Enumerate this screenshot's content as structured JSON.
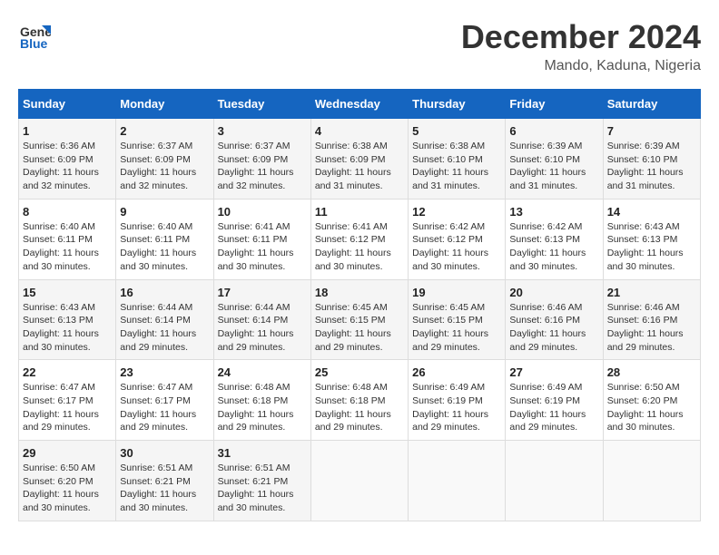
{
  "logo": {
    "line1": "General",
    "line2": "Blue"
  },
  "title": "December 2024",
  "subtitle": "Mando, Kaduna, Nigeria",
  "header": {
    "days": [
      "Sunday",
      "Monday",
      "Tuesday",
      "Wednesday",
      "Thursday",
      "Friday",
      "Saturday"
    ]
  },
  "weeks": [
    [
      {
        "day": "1",
        "info": "Sunrise: 6:36 AM\nSunset: 6:09 PM\nDaylight: 11 hours\nand 32 minutes."
      },
      {
        "day": "2",
        "info": "Sunrise: 6:37 AM\nSunset: 6:09 PM\nDaylight: 11 hours\nand 32 minutes."
      },
      {
        "day": "3",
        "info": "Sunrise: 6:37 AM\nSunset: 6:09 PM\nDaylight: 11 hours\nand 32 minutes."
      },
      {
        "day": "4",
        "info": "Sunrise: 6:38 AM\nSunset: 6:09 PM\nDaylight: 11 hours\nand 31 minutes."
      },
      {
        "day": "5",
        "info": "Sunrise: 6:38 AM\nSunset: 6:10 PM\nDaylight: 11 hours\nand 31 minutes."
      },
      {
        "day": "6",
        "info": "Sunrise: 6:39 AM\nSunset: 6:10 PM\nDaylight: 11 hours\nand 31 minutes."
      },
      {
        "day": "7",
        "info": "Sunrise: 6:39 AM\nSunset: 6:10 PM\nDaylight: 11 hours\nand 31 minutes."
      }
    ],
    [
      {
        "day": "8",
        "info": "Sunrise: 6:40 AM\nSunset: 6:11 PM\nDaylight: 11 hours\nand 30 minutes."
      },
      {
        "day": "9",
        "info": "Sunrise: 6:40 AM\nSunset: 6:11 PM\nDaylight: 11 hours\nand 30 minutes."
      },
      {
        "day": "10",
        "info": "Sunrise: 6:41 AM\nSunset: 6:11 PM\nDaylight: 11 hours\nand 30 minutes."
      },
      {
        "day": "11",
        "info": "Sunrise: 6:41 AM\nSunset: 6:12 PM\nDaylight: 11 hours\nand 30 minutes."
      },
      {
        "day": "12",
        "info": "Sunrise: 6:42 AM\nSunset: 6:12 PM\nDaylight: 11 hours\nand 30 minutes."
      },
      {
        "day": "13",
        "info": "Sunrise: 6:42 AM\nSunset: 6:13 PM\nDaylight: 11 hours\nand 30 minutes."
      },
      {
        "day": "14",
        "info": "Sunrise: 6:43 AM\nSunset: 6:13 PM\nDaylight: 11 hours\nand 30 minutes."
      }
    ],
    [
      {
        "day": "15",
        "info": "Sunrise: 6:43 AM\nSunset: 6:13 PM\nDaylight: 11 hours\nand 30 minutes."
      },
      {
        "day": "16",
        "info": "Sunrise: 6:44 AM\nSunset: 6:14 PM\nDaylight: 11 hours\nand 29 minutes."
      },
      {
        "day": "17",
        "info": "Sunrise: 6:44 AM\nSunset: 6:14 PM\nDaylight: 11 hours\nand 29 minutes."
      },
      {
        "day": "18",
        "info": "Sunrise: 6:45 AM\nSunset: 6:15 PM\nDaylight: 11 hours\nand 29 minutes."
      },
      {
        "day": "19",
        "info": "Sunrise: 6:45 AM\nSunset: 6:15 PM\nDaylight: 11 hours\nand 29 minutes."
      },
      {
        "day": "20",
        "info": "Sunrise: 6:46 AM\nSunset: 6:16 PM\nDaylight: 11 hours\nand 29 minutes."
      },
      {
        "day": "21",
        "info": "Sunrise: 6:46 AM\nSunset: 6:16 PM\nDaylight: 11 hours\nand 29 minutes."
      }
    ],
    [
      {
        "day": "22",
        "info": "Sunrise: 6:47 AM\nSunset: 6:17 PM\nDaylight: 11 hours\nand 29 minutes."
      },
      {
        "day": "23",
        "info": "Sunrise: 6:47 AM\nSunset: 6:17 PM\nDaylight: 11 hours\nand 29 minutes."
      },
      {
        "day": "24",
        "info": "Sunrise: 6:48 AM\nSunset: 6:18 PM\nDaylight: 11 hours\nand 29 minutes."
      },
      {
        "day": "25",
        "info": "Sunrise: 6:48 AM\nSunset: 6:18 PM\nDaylight: 11 hours\nand 29 minutes."
      },
      {
        "day": "26",
        "info": "Sunrise: 6:49 AM\nSunset: 6:19 PM\nDaylight: 11 hours\nand 29 minutes."
      },
      {
        "day": "27",
        "info": "Sunrise: 6:49 AM\nSunset: 6:19 PM\nDaylight: 11 hours\nand 29 minutes."
      },
      {
        "day": "28",
        "info": "Sunrise: 6:50 AM\nSunset: 6:20 PM\nDaylight: 11 hours\nand 30 minutes."
      }
    ],
    [
      {
        "day": "29",
        "info": "Sunrise: 6:50 AM\nSunset: 6:20 PM\nDaylight: 11 hours\nand 30 minutes."
      },
      {
        "day": "30",
        "info": "Sunrise: 6:51 AM\nSunset: 6:21 PM\nDaylight: 11 hours\nand 30 minutes."
      },
      {
        "day": "31",
        "info": "Sunrise: 6:51 AM\nSunset: 6:21 PM\nDaylight: 11 hours\nand 30 minutes."
      },
      {
        "day": "",
        "info": ""
      },
      {
        "day": "",
        "info": ""
      },
      {
        "day": "",
        "info": ""
      },
      {
        "day": "",
        "info": ""
      }
    ]
  ]
}
